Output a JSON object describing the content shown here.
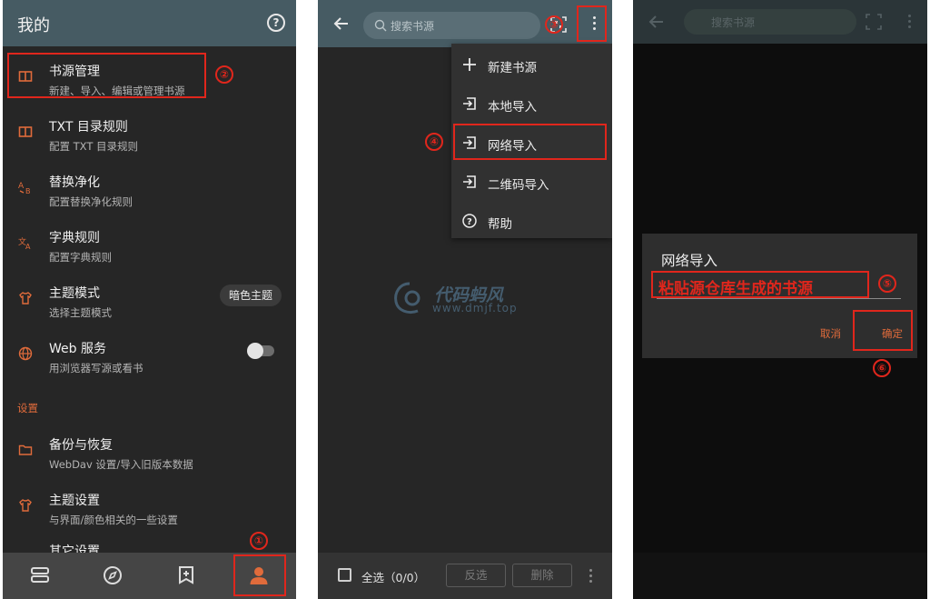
{
  "panel1": {
    "title": "我的",
    "items": [
      {
        "title": "书源管理",
        "summary": "新建、导入、编辑或管理书源",
        "icon": "book-icon"
      },
      {
        "title": "TXT 目录规则",
        "summary": "配置 TXT 目录规则",
        "icon": "book-icon"
      },
      {
        "title": "替换净化",
        "summary": "配置替换净化规则",
        "icon": "replace-icon"
      },
      {
        "title": "字典规则",
        "summary": "配置字典规则",
        "icon": "translate-icon"
      },
      {
        "title": "主题模式",
        "summary": "选择主题模式",
        "icon": "shirt-icon"
      },
      {
        "title": "Web 服务",
        "summary": "用浏览器写源或看书",
        "icon": "globe-icon"
      }
    ],
    "theme_chip": "暗色主题",
    "section_settings": "设置",
    "settings_items": [
      {
        "title": "备份与恢复",
        "summary": "WebDav 设置/导入旧版本数据",
        "icon": "folder-icon"
      },
      {
        "title": "主题设置",
        "summary": "与界面/颜色相关的一些设置",
        "icon": "shirt-icon"
      },
      {
        "title": "其它设置",
        "summary": "",
        "icon": "settings-icon"
      }
    ],
    "nav": [
      "bookshelf-icon",
      "explore-icon",
      "rss-icon",
      "profile-icon"
    ],
    "annotations": {
      "n1": "①",
      "n2": "②"
    }
  },
  "panel2": {
    "search_placeholder": "搜索书源",
    "menu": [
      {
        "label": "新建书源",
        "icon": "plus-icon"
      },
      {
        "label": "本地导入",
        "icon": "import-icon"
      },
      {
        "label": "网络导入",
        "icon": "import-icon"
      },
      {
        "label": "二维码导入",
        "icon": "import-icon"
      },
      {
        "label": "帮助",
        "icon": "help-icon"
      }
    ],
    "watermark_main": "代码蚂风",
    "watermark_url": "www.dmjf.top",
    "select_all": "全选（0/0）",
    "invert": "反选",
    "delete": "删除",
    "annotations": {
      "n3": "③",
      "n4": "④"
    }
  },
  "panel3": {
    "search_placeholder": "搜索书源",
    "dialog_title": "网络导入",
    "dialog_input": "粘贴源仓库生成的书源",
    "cancel": "取消",
    "confirm": "确定",
    "annotations": {
      "n5": "⑤",
      "n6": "⑥"
    }
  }
}
